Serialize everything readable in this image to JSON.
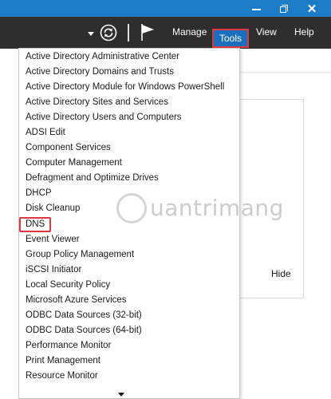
{
  "titlebar": {
    "buttons": [
      "minimize",
      "restore",
      "close"
    ],
    "close_glyph": "✕"
  },
  "toolbar": {
    "icons": [
      "refresh-icon",
      "flag-icon"
    ],
    "menus": [
      "Manage",
      "Tools",
      "View",
      "Help"
    ],
    "active_menu": "Tools"
  },
  "tools_menu": {
    "items": [
      "Active Directory Administrative Center",
      "Active Directory Domains and Trusts",
      "Active Directory Module for Windows PowerShell",
      "Active Directory Sites and Services",
      "Active Directory Users and Computers",
      "ADSI Edit",
      "Component Services",
      "Computer Management",
      "Defragment and Optimize Drives",
      "DHCP",
      "Disk Cleanup",
      "DNS",
      "Event Viewer",
      "Group Policy Management",
      "iSCSI Initiator",
      "Local Security Policy",
      "Microsoft Azure Services",
      "ODBC Data Sources (32-bit)",
      "ODBC Data Sources (64-bit)",
      "Performance Monitor",
      "Print Management",
      "Resource Monitor"
    ],
    "highlighted_item": "DNS"
  },
  "background": {
    "hide_label": "Hide"
  },
  "watermark": {
    "text": "uantrimang"
  },
  "colors": {
    "titlebar": "#1d7cc8",
    "toolbar": "#2e2e2e",
    "tools_active": "#1b6fbd",
    "highlight_border": "#e0383e"
  }
}
